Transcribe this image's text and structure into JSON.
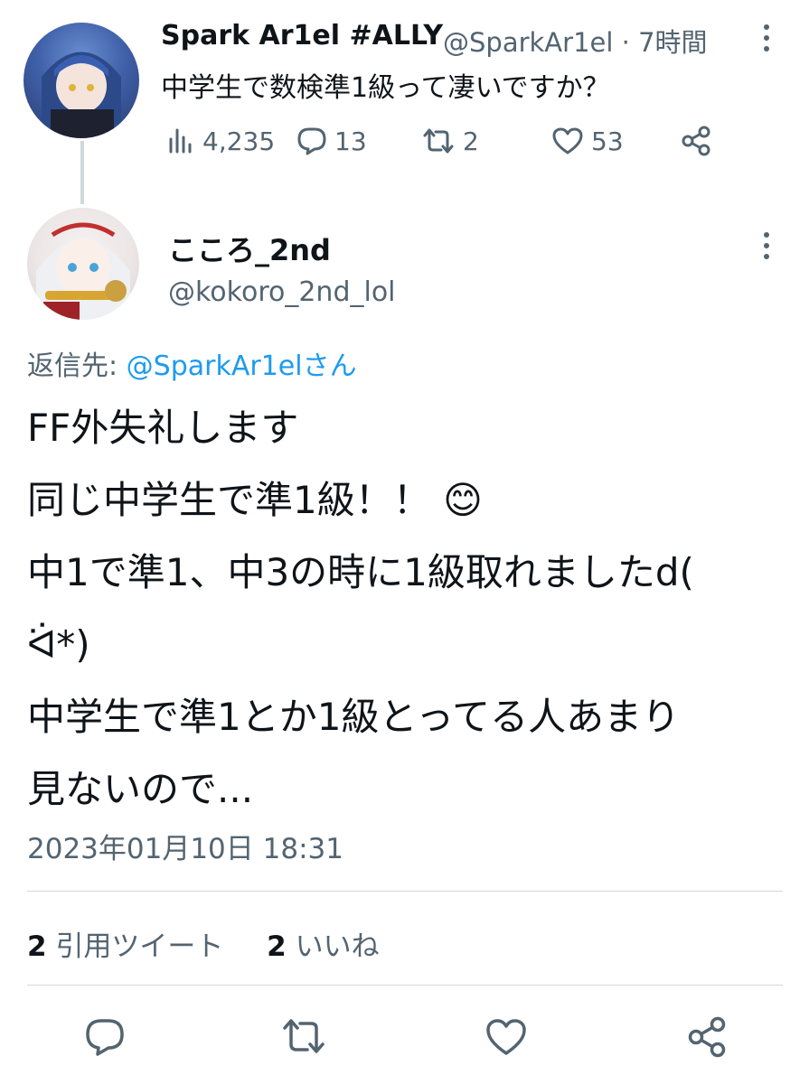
{
  "colors": {
    "text": "#0f1419",
    "secondary": "#536471",
    "link": "#1d9bf0",
    "divider": "#cfd9de"
  },
  "parent_tweet": {
    "display_name": "Spark Ar1el #ALLY",
    "meta": "@SparkAr1el · 7時間",
    "text": "中学生で数検準1級って凄いですか？",
    "stats": {
      "views": "4,235",
      "replies": "13",
      "retweets": "2",
      "likes": "53"
    }
  },
  "reply_tweet": {
    "display_name": "こころ_2nd",
    "handle": "@kokoro_2nd_lol",
    "reply_to_label": "返信先: ",
    "reply_to_user": "@SparkAr1elさん",
    "lines": [
      "FF外失礼します",
      "同じ中学生で準1級！！",
      "中1で準1、中3の時に1級取れましたd(",
      "ᐛ*)",
      "中学生で準1とか1級とってる人あまり",
      "見ないので..."
    ],
    "emoji": "😊",
    "timestamp": "2023年01月10日 18:31",
    "quote_count": "2",
    "quote_label": "引用ツイート",
    "like_count": "2",
    "like_label": "いいね"
  },
  "icons": [
    "more-icon",
    "views-icon",
    "reply-icon",
    "retweet-icon",
    "like-icon",
    "share-icon"
  ]
}
